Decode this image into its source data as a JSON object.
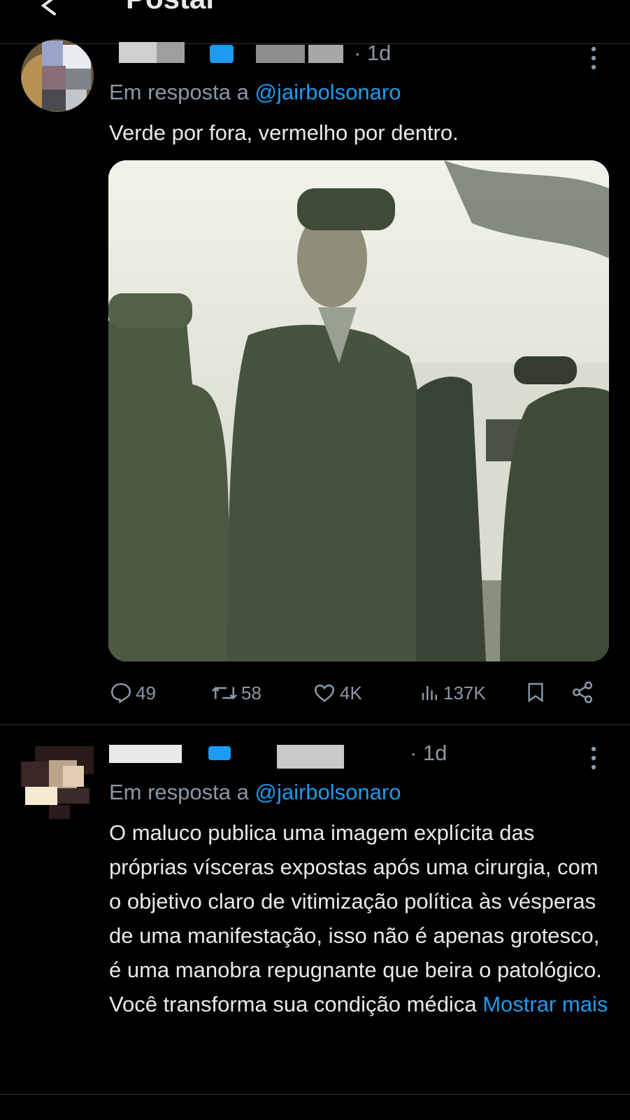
{
  "header": {
    "title": "Postar"
  },
  "tweets": [
    {
      "time": "· 1d",
      "reply_prefix": "Em resposta a",
      "reply_handle": "@jairbolsonaro",
      "text": "Verde por fora, vermelho por dentro.",
      "stats": {
        "replies": "49",
        "retweets": "58",
        "likes": "4K",
        "views": "137K"
      }
    },
    {
      "time": "· 1d",
      "reply_prefix": "Em resposta a",
      "reply_handle": "@jairbolsonaro",
      "text": "O maluco publica uma imagem explícita das próprias vísceras expostas após uma cirurgia, com o objetivo claro de vitimização política às vésperas de uma manifestação, isso não é apenas grotesco, é uma manobra repugnante que beira o patológico. Você transforma sua condição médica",
      "show_more": "Mostrar mais"
    }
  ],
  "icons": {
    "back": "arrow-left-icon",
    "more": "more-vertical-icon",
    "reply": "reply-icon",
    "retweet": "retweet-icon",
    "like": "heart-icon",
    "views": "views-icon",
    "bookmark": "bookmark-icon",
    "share": "share-icon"
  },
  "colors": {
    "background": "#000000",
    "text": "#e7e9ea",
    "muted": "#8b98a5",
    "accent": "#1d9bf0",
    "divider": "#2f3336"
  }
}
